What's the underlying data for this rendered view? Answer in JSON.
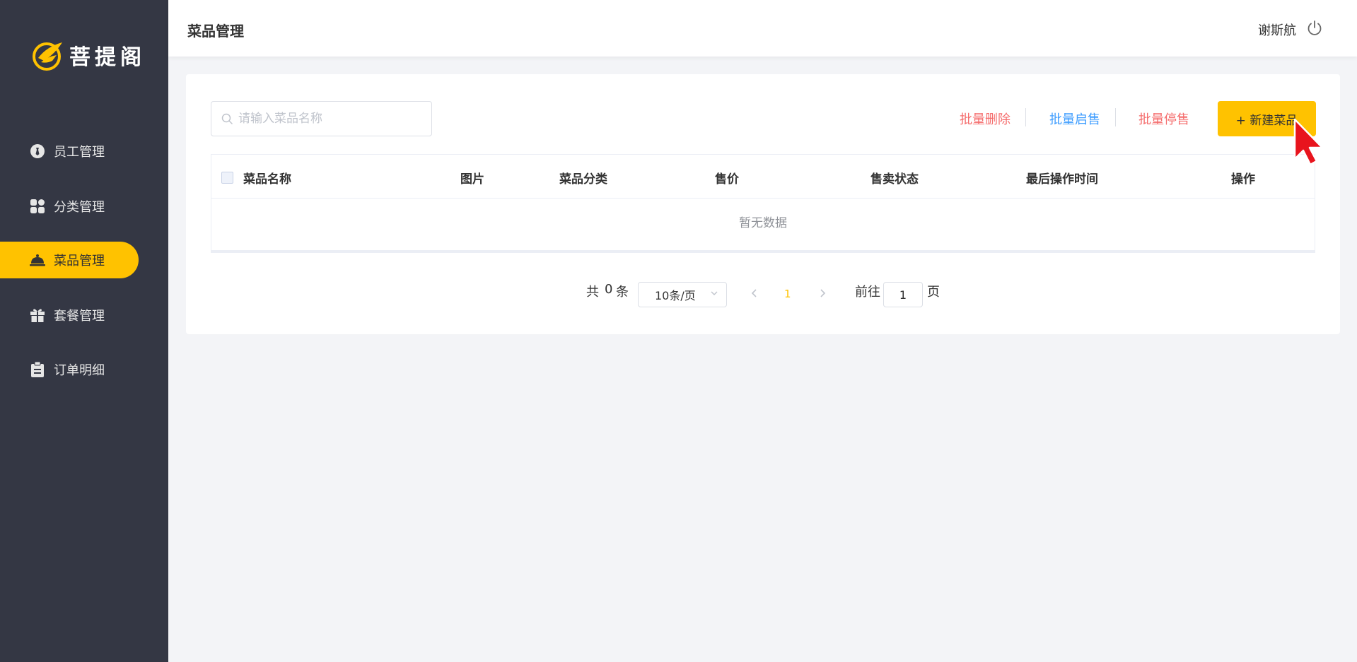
{
  "app": {
    "logo_text": "菩提阁"
  },
  "sidebar": {
    "items": [
      {
        "label": "员工管理",
        "icon": "employee-icon",
        "active": false
      },
      {
        "label": "分类管理",
        "icon": "category-grid-icon",
        "active": false
      },
      {
        "label": "菜品管理",
        "icon": "dish-cloche-icon",
        "active": true
      },
      {
        "label": "套餐管理",
        "icon": "gift-icon",
        "active": false
      },
      {
        "label": "订单明细",
        "icon": "clipboard-icon",
        "active": false
      }
    ]
  },
  "header": {
    "title": "菜品管理",
    "user_name": "谢斯航",
    "logout_icon": "power-icon"
  },
  "toolbar": {
    "search_placeholder": "请输入菜品名称",
    "batch_delete": "批量删除",
    "batch_enable": "批量启售",
    "batch_disable": "批量停售",
    "new_dish": "+ 新建菜品"
  },
  "table": {
    "columns": [
      "菜品名称",
      "图片",
      "菜品分类",
      "售价",
      "售卖状态",
      "最后操作时间",
      "操作"
    ],
    "empty_text": "暂无数据"
  },
  "pagination": {
    "total_prefix": "共",
    "total": "0",
    "total_suffix": "条",
    "page_size": "10条/页",
    "current_page": "1",
    "goto_prefix": "前往",
    "goto_value": "1",
    "goto_suffix": "页"
  },
  "colors": {
    "sidebar_bg": "#343744",
    "accent": "#ffc200",
    "danger": "#f56c6c",
    "info": "#409eff"
  }
}
